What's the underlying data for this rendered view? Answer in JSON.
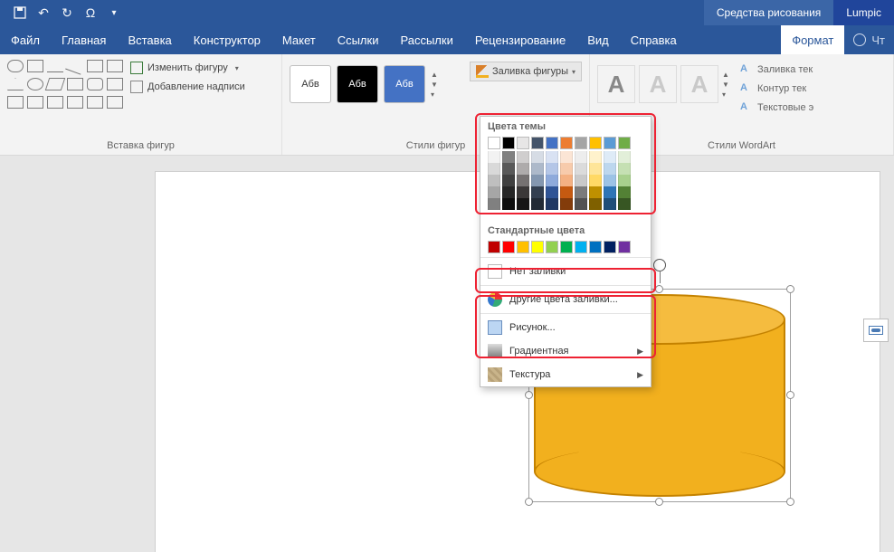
{
  "titlebar": {
    "tools_tab": "Средства рисования",
    "brand": "Lumpic"
  },
  "tabs": {
    "file": "Файл",
    "items": [
      "Главная",
      "Вставка",
      "Конструктор",
      "Макет",
      "Ссылки",
      "Рассылки",
      "Рецензирование",
      "Вид",
      "Справка"
    ],
    "format": "Формат",
    "tell_me": "Чт"
  },
  "ribbon": {
    "insert_shapes": {
      "edit_shape": "Изменить фигуру",
      "text_box": "Добавление надписи",
      "label": "Вставка фигур"
    },
    "shape_styles": {
      "sample": "Абв",
      "fill_btn": "Заливка фигуры",
      "label": "Стили фигур"
    },
    "wordart": {
      "fill": "Заливка тек",
      "outline": "Контур тек",
      "effects": "Текстовые э",
      "label": "Стили WordArt"
    }
  },
  "dropdown": {
    "theme_colors": "Цвета темы",
    "standard_colors": "Стандартные цвета",
    "no_fill": "Нет заливки",
    "more_colors": "Другие цвета заливки...",
    "picture": "Рисунок...",
    "gradient": "Градиентная",
    "texture": "Текстура",
    "theme_row": [
      "#ffffff",
      "#000000",
      "#e7e6e6",
      "#44546a",
      "#4472c4",
      "#ed7d31",
      "#a5a5a5",
      "#ffc000",
      "#5b9bd5",
      "#70ad47"
    ],
    "theme_shades": [
      [
        "#f2f2f2",
        "#d9d9d9",
        "#bfbfbf",
        "#a6a6a6",
        "#808080"
      ],
      [
        "#808080",
        "#595959",
        "#404040",
        "#262626",
        "#0d0d0d"
      ],
      [
        "#d0cece",
        "#aeabab",
        "#757171",
        "#3b3838",
        "#171616"
      ],
      [
        "#d6dce5",
        "#adb9ca",
        "#8497b0",
        "#333f50",
        "#222a35"
      ],
      [
        "#d9e2f3",
        "#b4c6e7",
        "#8eaadb",
        "#2f5496",
        "#1f3864"
      ],
      [
        "#fbe5d5",
        "#f7cbac",
        "#f4b183",
        "#c55a11",
        "#833c0b"
      ],
      [
        "#ededed",
        "#dbdbdb",
        "#c9c9c9",
        "#7b7b7b",
        "#525252"
      ],
      [
        "#fff2cc",
        "#fee599",
        "#ffd965",
        "#bf9000",
        "#7f6000"
      ],
      [
        "#deebf7",
        "#bdd7ee",
        "#9cc3e6",
        "#2e75b6",
        "#1e4e79"
      ],
      [
        "#e2efd9",
        "#c5e0b3",
        "#a8d08d",
        "#538135",
        "#375623"
      ]
    ],
    "standard_row": [
      "#c00000",
      "#ff0000",
      "#ffc000",
      "#ffff00",
      "#92d050",
      "#00b050",
      "#00b0f0",
      "#0070c0",
      "#002060",
      "#7030a0"
    ]
  }
}
